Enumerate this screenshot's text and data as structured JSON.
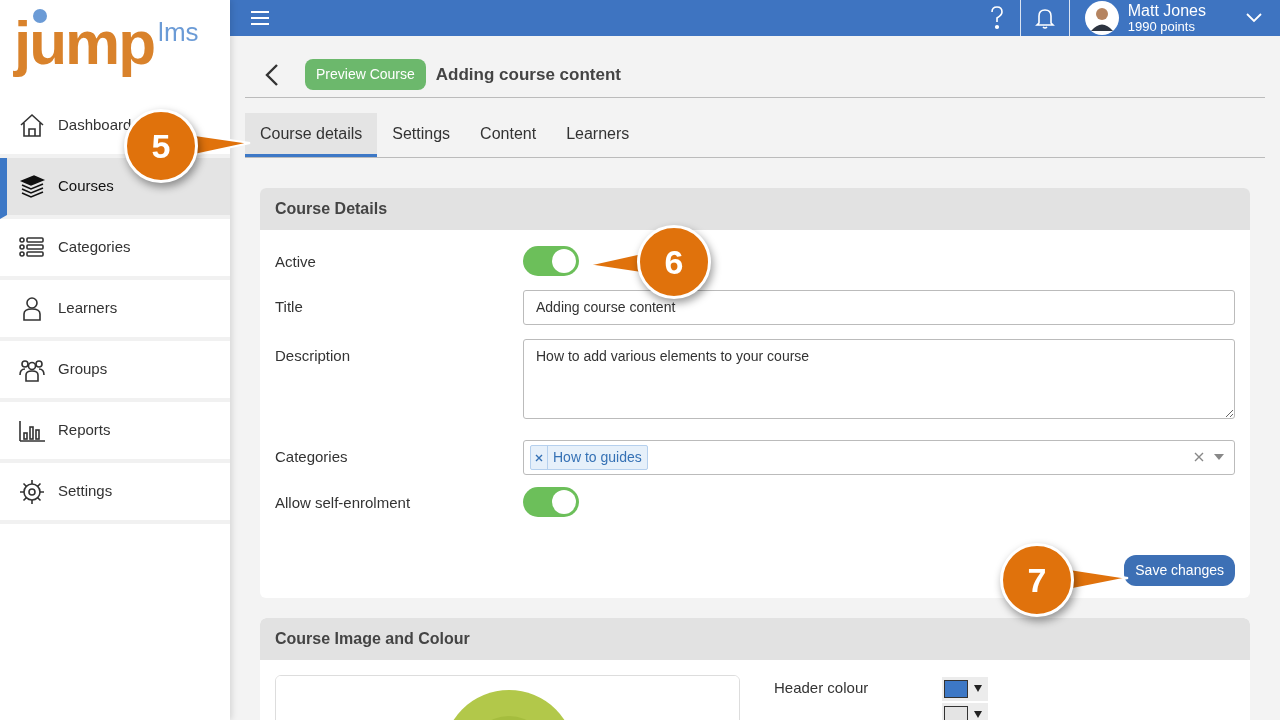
{
  "logo": {
    "main": "jump",
    "suffix": "lms"
  },
  "sidebar": {
    "items": [
      {
        "label": "Dashboard",
        "selected": false
      },
      {
        "label": "Courses",
        "selected": true
      },
      {
        "label": "Categories",
        "selected": false
      },
      {
        "label": "Learners",
        "selected": false
      },
      {
        "label": "Groups",
        "selected": false
      },
      {
        "label": "Reports",
        "selected": false
      },
      {
        "label": "Settings",
        "selected": false
      }
    ]
  },
  "topbar": {
    "user": {
      "name": "Matt Jones",
      "points": "1990 points"
    }
  },
  "page_header": {
    "preview_button": "Preview Course",
    "title": "Adding course content"
  },
  "tabs": [
    {
      "label": "Course details",
      "selected": true
    },
    {
      "label": "Settings",
      "selected": false
    },
    {
      "label": "Content",
      "selected": false
    },
    {
      "label": "Learners",
      "selected": false
    }
  ],
  "course_details": {
    "title": "Course Details",
    "fields": [
      {
        "kind": "toggle",
        "label": "Active",
        "on": true
      },
      {
        "kind": "text",
        "label": "Title",
        "value": "Adding course content"
      },
      {
        "kind": "textarea",
        "label": "Description",
        "value": "How to add various elements to your course"
      },
      {
        "kind": "tags",
        "label": "Categories",
        "tags": [
          "How to guides"
        ]
      },
      {
        "kind": "toggle",
        "label": "Allow self-enrolment",
        "on": true
      }
    ],
    "save_button": "Save changes"
  },
  "course_image": {
    "title": "Course Image and Colour",
    "colours": [
      {
        "label": "Header colour",
        "color": "#3d78c6"
      },
      {
        "color": "#e4e4e4"
      }
    ]
  },
  "callouts": [
    {
      "number": "5"
    },
    {
      "number": "6"
    },
    {
      "number": "7"
    }
  ]
}
